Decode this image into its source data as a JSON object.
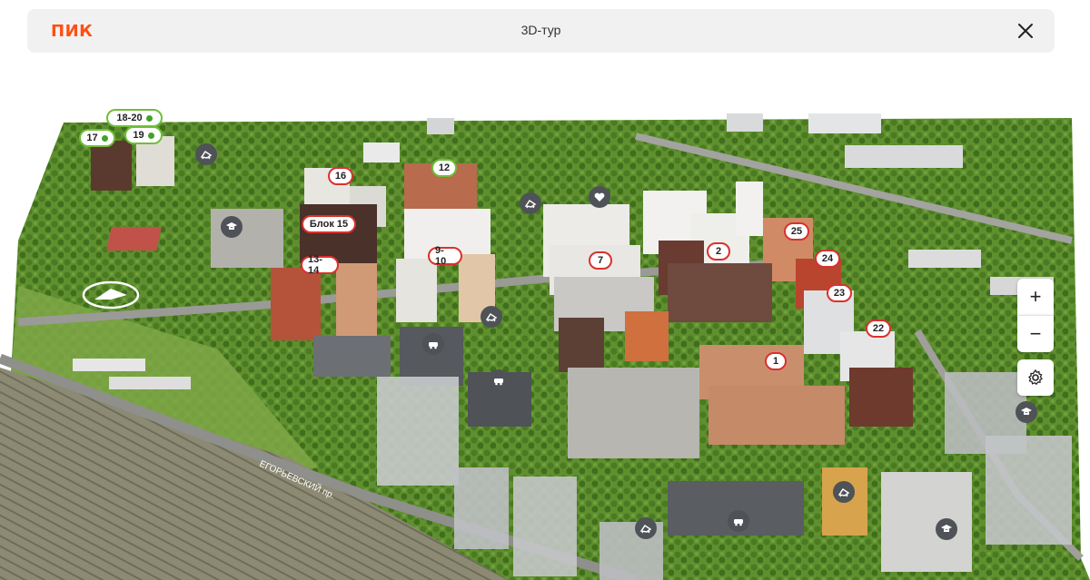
{
  "header": {
    "logo": "ПИК",
    "title": "3D-тур"
  },
  "colors": {
    "brand": "#ff4f12",
    "marker_border": "#d9312e",
    "marker_border_sale": "#6fbf3a",
    "poi_bg": "#4f5257"
  },
  "markers": [
    {
      "label": "18-20",
      "sale": true
    },
    {
      "label": "17",
      "sale": true
    },
    {
      "label": "19",
      "sale": true
    },
    {
      "label": "12",
      "sale": false
    },
    {
      "label": "16",
      "sale": false
    },
    {
      "label": "Блок 15",
      "sale": false
    },
    {
      "label": "13-14",
      "sale": false
    },
    {
      "label": "9-10",
      "sale": false
    },
    {
      "label": "7",
      "sale": false
    },
    {
      "label": "2",
      "sale": false
    },
    {
      "label": "25",
      "sale": false
    },
    {
      "label": "24",
      "sale": false
    },
    {
      "label": "23",
      "sale": false
    },
    {
      "label": "22",
      "sale": false
    },
    {
      "label": "1",
      "sale": false
    }
  ],
  "poi_icons": [
    "kindergarten-icon",
    "school-icon",
    "kindergarten-icon",
    "heart-icon",
    "kindergarten-icon",
    "parking-icon",
    "parking-icon",
    "school-icon",
    "kindergarten-icon",
    "parking-icon",
    "kindergarten-icon",
    "school-icon"
  ],
  "map_labels": {
    "street": "ЕГОРЬЕВСКИЙ пр."
  },
  "controls": {
    "zoom_in": "+",
    "zoom_out": "−"
  }
}
